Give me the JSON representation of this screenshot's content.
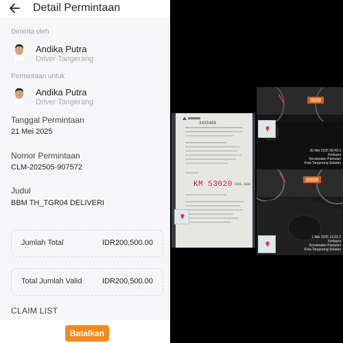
{
  "header": {
    "title": "Detail Permintaan"
  },
  "requested_by": {
    "label": "Diminta oleh",
    "name": "Andika Putra",
    "role": "Driver Tangerang"
  },
  "requested_for": {
    "label": "Permintaan untuk",
    "name": "Andika Putra",
    "role": "Driver Tangerang"
  },
  "request_date": {
    "label": "Tanggal Permintaan",
    "value": "21 Mei 2025"
  },
  "request_number": {
    "label": "Nomor Permintaan",
    "value": "CLM-202505-907572"
  },
  "title_field": {
    "label": "Judul",
    "value": "BBM TH_TGR04 DELIVERI"
  },
  "total": {
    "label": "Jumlah Total",
    "amount": "IDR200,500.00"
  },
  "valid_total": {
    "label": "Total Jumlah Valid",
    "amount": "IDR200,500.00"
  },
  "claim_list": {
    "label": "CLAIM LIST"
  },
  "actions": {
    "cancel_label": "Batalkan"
  },
  "receipt": {
    "station_no": "3415406",
    "km_handwritten": "KM 53020",
    "total_text": "200.500"
  },
  "dashboard": {
    "timestamp_top": "20 Mei 2025 08.40.3",
    "location_top_1": "Kedaura",
    "location_top_2": "Kecamatan Pamulan",
    "location_top_3": "Kota Tangerang Selatan",
    "timestamp_bottom": "1 Mei 2025 13.03.2",
    "location_bottom_1": "Kedaura",
    "location_bottom_2": "Kecamatan Pamulan",
    "location_bottom_3": "Kota Tangerang Selatan"
  },
  "colors": {
    "accent": "#f28a1f",
    "ink": "#c21a3b"
  }
}
